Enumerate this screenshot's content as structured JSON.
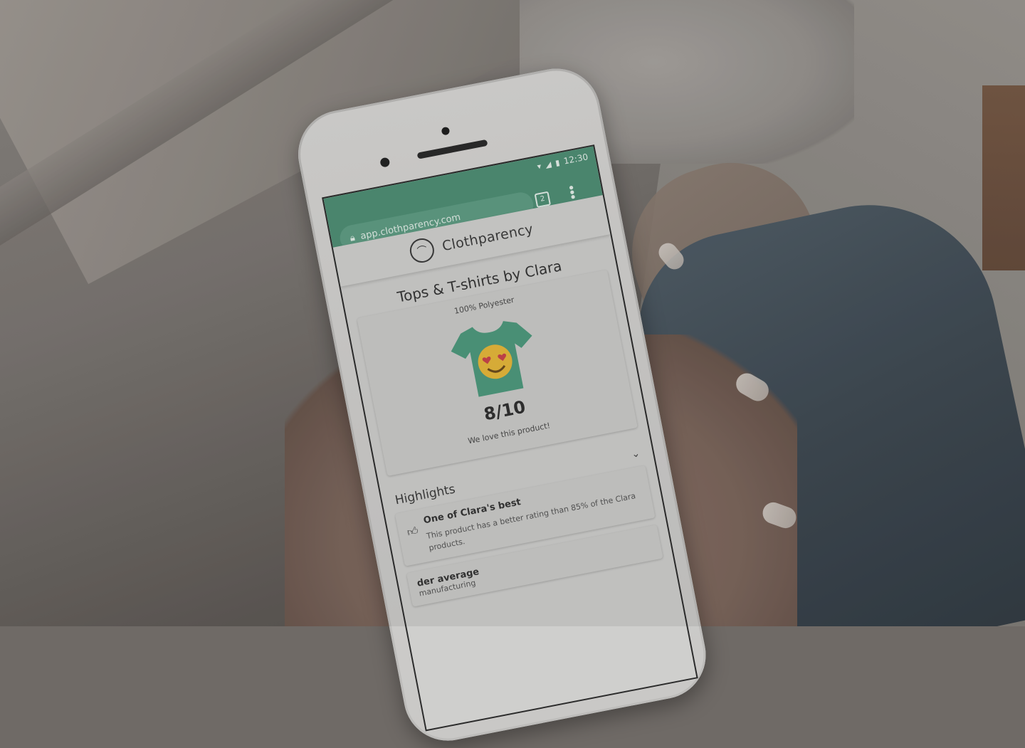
{
  "status_bar": {
    "time": "12:30"
  },
  "browser": {
    "url": "app.clothparency.com",
    "tab_count": "2",
    "lock_icon": "lock-icon",
    "menu_icon": "more-vert-icon"
  },
  "site": {
    "brand": "Clothparency",
    "logo_icon": "hanger-tag-icon"
  },
  "product": {
    "title": "Tops & T-shirts by Clara",
    "material": "100% Polyester",
    "score": "8/10",
    "verdict": "We love this product!",
    "image_icon": "tshirt-heart-eyes-emoji-icon",
    "shirt_color": "#4fa383"
  },
  "highlights": {
    "title": "Highlights",
    "expand_icon": "chevron-down-icon",
    "items": [
      {
        "title": "One of Clara's best",
        "description": "This product has a better rating than 85% of the Clara products.",
        "icon": "thumbs-up-icon"
      },
      {
        "title": "der average",
        "description": "manufacturing"
      }
    ]
  },
  "colors": {
    "accent": "#4f8f75",
    "screen_bg": "#cfcfcd"
  }
}
